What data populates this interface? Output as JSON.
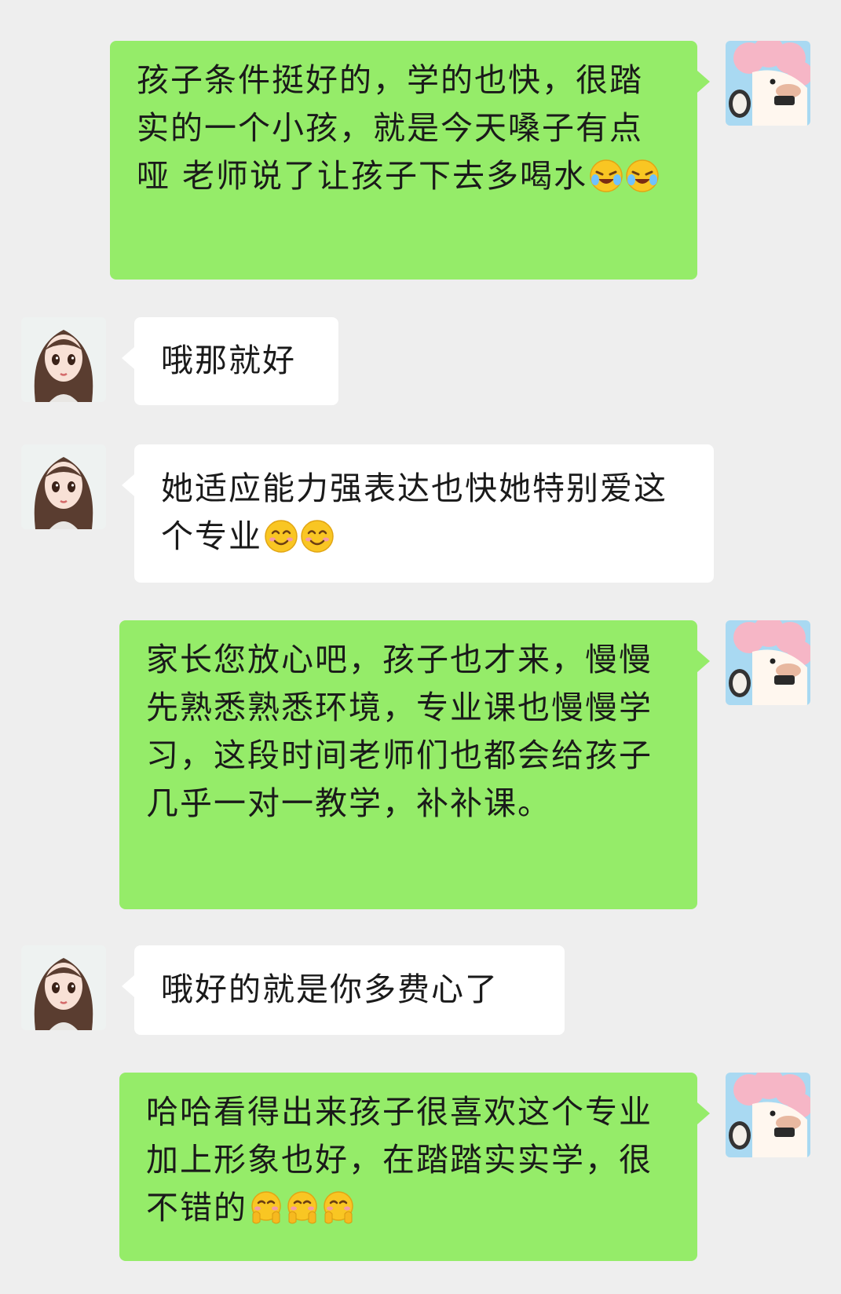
{
  "messages": [
    {
      "side": "sent",
      "text": "孩子条件挺好的，学的也快，很踏实的一个小孩，就是今天嗓子有点哑 老师说了让孩子下去多喝水",
      "emoji": [
        "crying-laughing-emoji",
        "crying-laughing-emoji"
      ]
    },
    {
      "side": "received",
      "text": "哦那就好",
      "emoji": []
    },
    {
      "side": "received",
      "text": "她适应能力强表达也快她特别爱这个专业",
      "emoji": [
        "smiling-emoji",
        "smiling-emoji"
      ]
    },
    {
      "side": "sent",
      "text": "家长您放心吧，孩子也才来，慢慢先熟悉熟悉环境，专业课也慢慢学习，这段时间老师们也都会给孩子几乎一对一教学，补补课。",
      "emoji": []
    },
    {
      "side": "received",
      "text": "哦好的就是你多费心了",
      "emoji": []
    },
    {
      "side": "sent",
      "text": "哈哈看得出来孩子很喜欢这个专业 加上形象也好，在踏踏实实学，很不错的",
      "emoji": [
        "shy-hug-emoji",
        "shy-hug-emoji",
        "shy-hug-emoji"
      ]
    }
  ],
  "colors": {
    "background": "#eeeeee",
    "sent_bubble": "#95ec69",
    "received_bubble": "#ffffff",
    "text": "#1a1a1a"
  },
  "avatars": {
    "sender": "cartoon-sheep-avatar",
    "receiver": "anime-girl-avatar"
  }
}
